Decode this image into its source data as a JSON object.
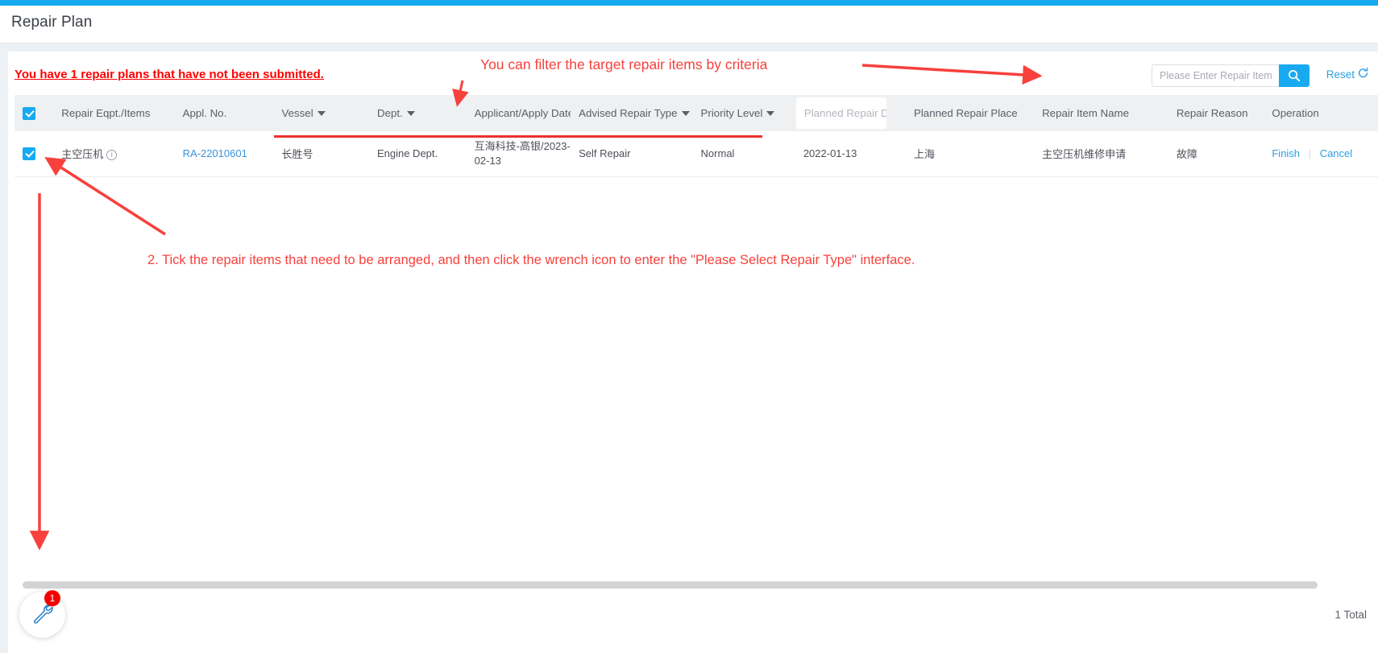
{
  "theme": {
    "accent": "#18aaf1",
    "link": "#2e9fe0",
    "annotation_red": "#f8403c",
    "warning_red": "#ff0000",
    "header_bg": "#eff0f2"
  },
  "page": {
    "title": "Repair Plan"
  },
  "warning": {
    "text": "You have 1 repair plans that have not been submitted."
  },
  "search": {
    "placeholder": "Please Enter Repair Item",
    "value": "",
    "button_icon": "search-icon",
    "reset_label": "Reset",
    "reset_icon": "refresh-icon"
  },
  "table": {
    "columns": [
      {
        "key": "check",
        "label": "",
        "sortable": false,
        "type": "checkbox"
      },
      {
        "key": "eqpt",
        "label": "Repair Eqpt./Items",
        "sortable": false
      },
      {
        "key": "appl",
        "label": "Appl. No.",
        "sortable": false
      },
      {
        "key": "vessel",
        "label": "Vessel",
        "sortable": true
      },
      {
        "key": "dept",
        "label": "Dept.",
        "sortable": true
      },
      {
        "key": "applicant",
        "label": "Applicant/Apply Date",
        "sortable": false
      },
      {
        "key": "advised",
        "label": "Advised Repair Type",
        "sortable": true
      },
      {
        "key": "priority",
        "label": "Priority Level",
        "sortable": true
      },
      {
        "key": "pdate",
        "label": "Planned Repair Date",
        "sortable": false,
        "type": "filter-pill"
      },
      {
        "key": "pplace",
        "label": "Planned Repair Place",
        "sortable": false
      },
      {
        "key": "iname",
        "label": "Repair Item Name",
        "sortable": false
      },
      {
        "key": "reason",
        "label": "Repair Reason",
        "sortable": false
      },
      {
        "key": "op",
        "label": "Operation",
        "sortable": false
      }
    ],
    "rows": [
      {
        "checked": true,
        "eqpt": "主空压机",
        "appl": "RA-22010601",
        "vessel": "长胜号",
        "dept": "Engine Dept.",
        "applicant": "互海科技-高银/2023-02-13",
        "advised": "Self Repair",
        "priority": "Normal",
        "pdate": "2022-01-13",
        "pplace": "上海",
        "iname": "主空压机维修申请",
        "reason": "故障",
        "op_finish": "Finish",
        "op_cancel": "Cancel"
      }
    ],
    "header_all_checked": true
  },
  "footer": {
    "total": "1 Total"
  },
  "fab": {
    "icon": "wrench-icon",
    "badge": "1"
  },
  "annotations": {
    "filter_hint": "You can filter the target repair items by criteria",
    "tick_hint": "2. Tick the repair items that need to be arranged, and then click the wrench icon to enter the \"Please Select Repair Type\" interface."
  }
}
